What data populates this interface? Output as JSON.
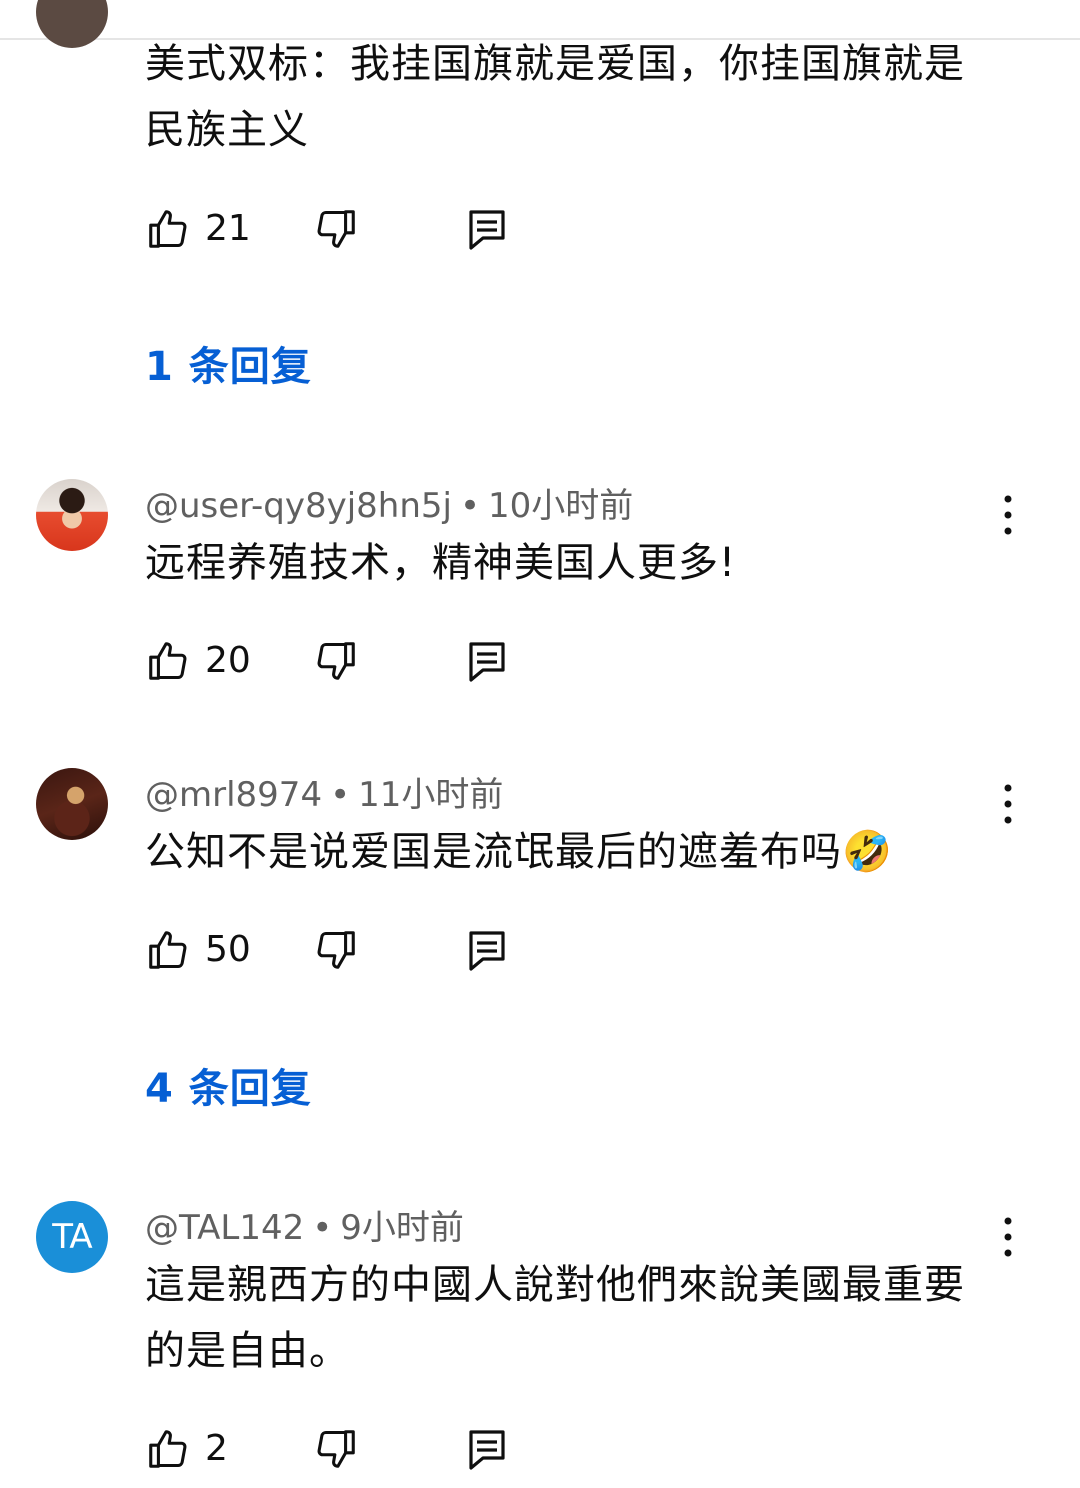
{
  "comments": [
    {
      "text": "美式双标：我挂国旗就是爱国，你挂国旗就是民族主义",
      "likes": "21",
      "replies_label": "1 条回复"
    },
    {
      "author": "@user-qy8yj8hn5j",
      "separator": "•",
      "time": "10小时前",
      "text": "远程养殖技术，精神美国人更多!",
      "likes": "20"
    },
    {
      "author": "@mrl8974",
      "separator": "•",
      "time": "11小时前",
      "text": "公知不是说爱国是流氓最后的遮羞布吗🤣",
      "likes": "50",
      "replies_label": "4 条回复"
    },
    {
      "author": "@TAL142",
      "separator": "•",
      "time": "9小时前",
      "avatar_letters": "TA",
      "text": "這是親西方的中國人說對他們來說美國最重要的是自由。",
      "likes": "2"
    }
  ],
  "colors": {
    "link": "#065fd4",
    "meta": "#606060",
    "avatar_ta": "#1a8fd8"
  },
  "icons": [
    "thumb-up-icon",
    "thumb-down-icon",
    "reply-icon",
    "more-vert-icon"
  ]
}
